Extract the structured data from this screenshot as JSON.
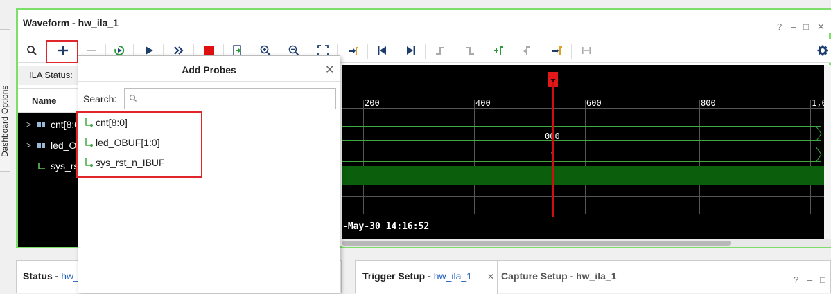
{
  "side_tab": {
    "label": "Dashboard Options"
  },
  "waveform": {
    "title": "Waveform - hw_ila_1",
    "controls": {
      "help": "?",
      "minimize": "–",
      "restore": "□",
      "close": "✕"
    },
    "ila_status_label": "ILA Status:",
    "name_header": "Name",
    "signals": [
      {
        "label": "cnt[8:0]",
        "expandable": true,
        "icon": "bus-icon"
      },
      {
        "label": "led_OBUF[1:0]",
        "expandable": true,
        "icon": "bus-icon"
      },
      {
        "label": "sys_rst_n_IBUF",
        "expandable": false,
        "icon": "wire-icon"
      }
    ],
    "ticks": [
      "200",
      "400",
      "600",
      "800",
      "1,0"
    ],
    "bus_values": {
      "cnt": "000",
      "led": "1"
    },
    "cursor_flag": "T",
    "timestamp": "-May-30 14:16:52"
  },
  "toolbar": {
    "icons": [
      "search-icon",
      "add-icon",
      "remove-icon",
      "run-trigger-icon",
      "run-icon",
      "run-immediate-icon",
      "stop-icon",
      "export-icon",
      "zoom-in-icon",
      "zoom-out-icon",
      "zoom-fit-icon",
      "go-to-cursor-icon",
      "first-marker-icon",
      "last-marker-icon",
      "prev-transition-icon",
      "next-transition-icon",
      "add-marker-icon",
      "prev-marker-icon",
      "next-marker-icon",
      "swap-cursors-icon",
      "settings-icon"
    ]
  },
  "add_probes": {
    "title": "Add Probes",
    "close": "✕",
    "search_label": "Search:",
    "search_value": "",
    "probes": [
      "cnt[8:0]",
      "led_OBUF[1:0]",
      "sys_rst_n_IBUF"
    ]
  },
  "status_panel": {
    "title": "Status - ",
    "link": "hw_"
  },
  "trigger_panel": {
    "tab_trigger_title": "Trigger Setup - ",
    "tab_trigger_link": "hw_ila_1",
    "tab_trigger_close": "✕",
    "tab_capture": "Capture Setup - hw_ila_1",
    "help": "?",
    "minimize": "–",
    "restore": "□"
  },
  "colors": {
    "highlight": "#7ede6a",
    "annotation": "#e0262b",
    "accent": "#1f5fbf"
  }
}
